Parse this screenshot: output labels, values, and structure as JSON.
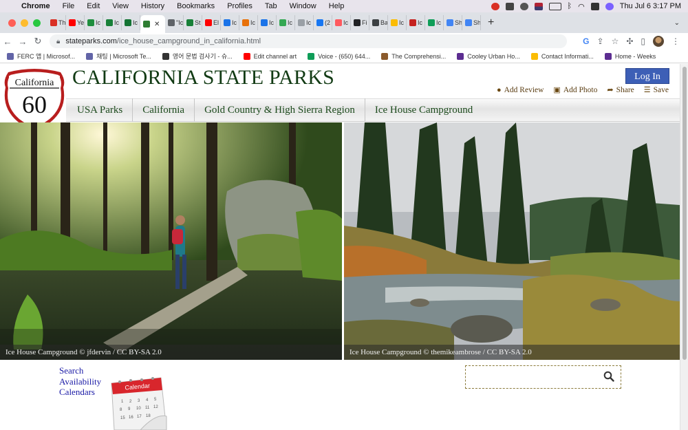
{
  "menubar": {
    "app": "Chrome",
    "items": [
      "File",
      "Edit",
      "View",
      "History",
      "Bookmarks",
      "Profiles",
      "Tab",
      "Window",
      "Help"
    ],
    "clock": "Thu Jul 6  3:17 PM"
  },
  "browser": {
    "tabs": [
      {
        "label": "Th",
        "color": "#d93025"
      },
      {
        "label": "Ye",
        "color": "#ff0000"
      },
      {
        "label": "Ic",
        "color": "#1e8e3e"
      },
      {
        "label": "Ic",
        "color": "#188038"
      },
      {
        "label": "Ic",
        "color": "#137333"
      },
      {
        "label": "",
        "color": "#2e7d32",
        "active": true
      },
      {
        "label": "\"Ic",
        "color": "#5f6368"
      },
      {
        "label": "St",
        "color": "#188038"
      },
      {
        "label": "El",
        "color": "#ff0000"
      },
      {
        "label": "Ic",
        "color": "#1a73e8"
      },
      {
        "label": "Ic",
        "color": "#e8710a"
      },
      {
        "label": "Ic",
        "color": "#1a73e8"
      },
      {
        "label": "Ic",
        "color": "#34a853"
      },
      {
        "label": "Ic",
        "color": "#9aa0a6"
      },
      {
        "label": "(2",
        "color": "#1877f2"
      },
      {
        "label": "Ic",
        "color": "#ff5a5f"
      },
      {
        "label": "Fi",
        "color": "#202124"
      },
      {
        "label": "Ba",
        "color": "#3c4043"
      },
      {
        "label": "Ic",
        "color": "#fbbc04"
      },
      {
        "label": "Ic",
        "color": "#c5221f"
      },
      {
        "label": "Ic",
        "color": "#0f9d58"
      },
      {
        "label": "Sh",
        "color": "#4285f4"
      },
      {
        "label": "Sh",
        "color": "#4285f4"
      }
    ],
    "url_host": "stateparks.com",
    "url_path": "/ice_house_campground_in_california.html",
    "bookmarks": [
      {
        "label": "FERC 앱 | Microsof...",
        "color": "#6264a7"
      },
      {
        "label": "채팅 | Microsoft Te...",
        "color": "#6264a7"
      },
      {
        "label": "영어 문법 검사기 - 슈...",
        "color": "#333333"
      },
      {
        "label": "Edit channel art",
        "color": "#ff0000"
      },
      {
        "label": "Voice - (650) 644...",
        "color": "#0f9d58"
      },
      {
        "label": "The Comprehensi...",
        "color": "#8b5a2b"
      },
      {
        "label": "Cooley Urban Ho...",
        "color": "#5c2d91"
      },
      {
        "label": "Contact Informati...",
        "color": "#fbbc04"
      },
      {
        "label": "Home - Weeks",
        "color": "#5c2d91"
      }
    ]
  },
  "site": {
    "logo_top": "California",
    "logo_number": "60",
    "title": "CALIFORNIA STATE PARKS",
    "login_label": "Log In",
    "actions": [
      {
        "label": "Add Review",
        "icon": "comment-icon"
      },
      {
        "label": "Add Photo",
        "icon": "photo-icon"
      },
      {
        "label": "Share",
        "icon": "share-icon"
      },
      {
        "label": "Save",
        "icon": "list-icon"
      }
    ],
    "breadcrumbs": [
      "USA Parks",
      "California",
      "Gold Country & High Sierra Region",
      "Ice House Campground"
    ],
    "photos": [
      {
        "caption": "Ice House Campground © jfdervin / CC BY-SA 2.0"
      },
      {
        "caption": "Ice House Campground © themikeambrose / CC BY-SA 2.0"
      }
    ],
    "search_links": [
      "Search",
      "Availability",
      "Calendars"
    ],
    "calendar_label": "Calendar",
    "search_placeholder": ""
  }
}
